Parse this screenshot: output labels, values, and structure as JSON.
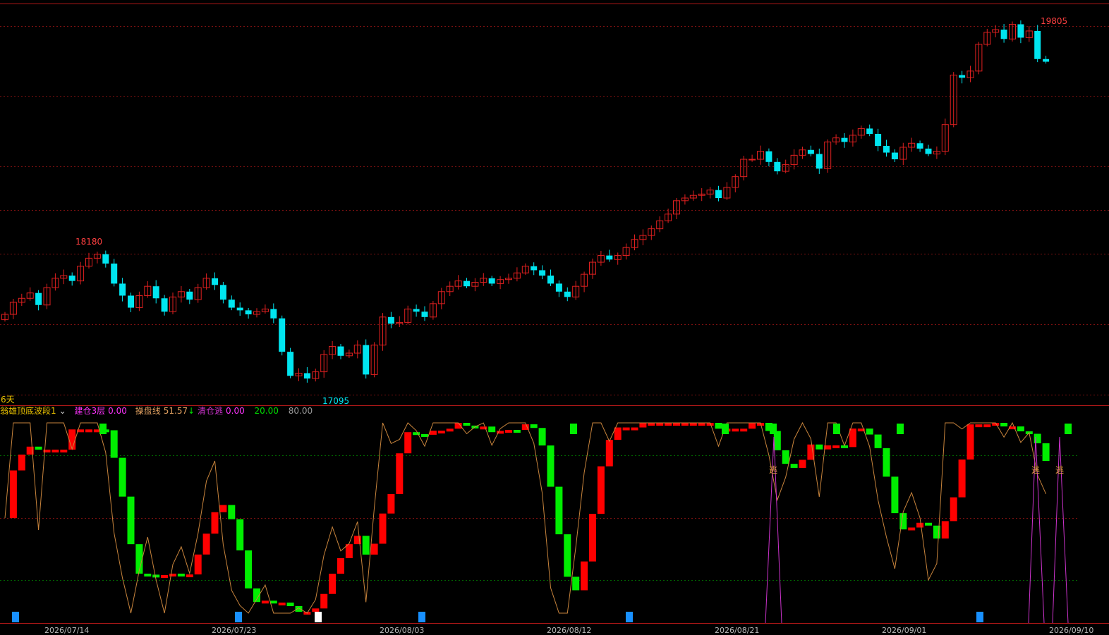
{
  "colors": {
    "background": "#000000",
    "up": "#e02020",
    "down": "#00e5f0",
    "grid_red": "#7a1010",
    "grid_green": "#006600",
    "indicator_red": "#ff0000",
    "indicator_green": "#00ee00",
    "operation_line": "#c8843c",
    "clear_signal": "#cc33cc",
    "marker_blue": "#1890ff",
    "marker_white": "#ffffff",
    "label_yellow": "#e8c000"
  },
  "main_chart": {
    "high_label": "19805",
    "mid_high_label": "18180",
    "low_label": "17095",
    "period_label": "6天"
  },
  "indicator": {
    "name": "翁雄顶底波段1",
    "dropdown_icon": "chevron-down-icon",
    "build_label": "建仓3层",
    "build_value": "0.00",
    "op_label": "操盘线",
    "op_value": "51.57",
    "op_arrow": "↓",
    "clear_label": "清仓逃",
    "clear_value": "0.00",
    "level_low": "20.00",
    "level_high": "80.00",
    "escape_glyph": "逃"
  },
  "x_axis": {
    "dates": [
      "2026/07/14",
      "2026/07/23",
      "2026/08/03",
      "2026/08/12",
      "2026/08/21",
      "2026/09/01",
      "2026/09/10"
    ]
  },
  "chart_data": [
    {
      "type": "candlestick",
      "title": "",
      "high_marker": 19805,
      "low_marker": 17095,
      "local_high_marker": 18180,
      "ylim": [
        16950,
        19950
      ],
      "close_series": [
        17630,
        17720,
        17750,
        17790,
        17700,
        17830,
        17900,
        17920,
        17880,
        17990,
        18050,
        18080,
        18010,
        17860,
        17770,
        17680,
        17770,
        17840,
        17750,
        17650,
        17760,
        17800,
        17740,
        17830,
        17900,
        17850,
        17740,
        17680,
        17660,
        17630,
        17650,
        17670,
        17600,
        17350,
        17170,
        17190,
        17150,
        17200,
        17330,
        17390,
        17320,
        17340,
        17400,
        17180,
        17400,
        17610,
        17560,
        17570,
        17670,
        17650,
        17610,
        17710,
        17800,
        17840,
        17880,
        17840,
        17870,
        17900,
        17860,
        17890,
        17900,
        17940,
        17990,
        17960,
        17920,
        17860,
        17800,
        17760,
        17840,
        17930,
        18020,
        18070,
        18040,
        18070,
        18130,
        18190,
        18220,
        18270,
        18330,
        18380,
        18480,
        18500,
        18520,
        18530,
        18560,
        18500,
        18580,
        18660,
        18790,
        18790,
        18850,
        18770,
        18700,
        18750,
        18820,
        18860,
        18830,
        18720,
        18920,
        18950,
        18920,
        18970,
        19020,
        18980,
        18890,
        18840,
        18790,
        18880,
        18910,
        18870,
        18830,
        18850,
        19050,
        19420,
        19400,
        19450,
        19650,
        19740,
        19760,
        19690,
        19800,
        19700,
        19750,
        19540,
        19520
      ]
    }
  ]
}
